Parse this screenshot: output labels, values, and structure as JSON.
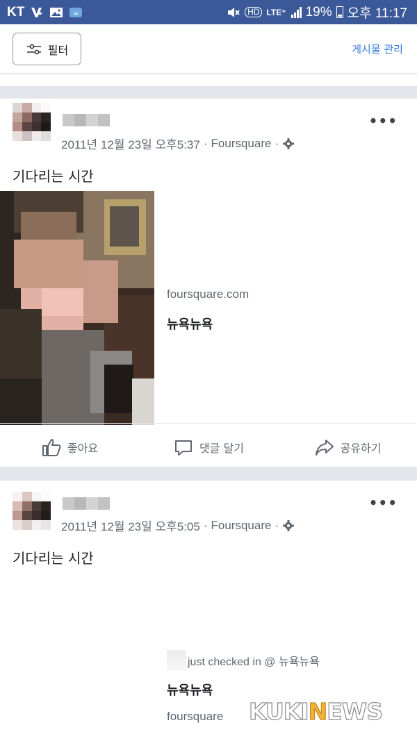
{
  "status_bar": {
    "carrier": "KT",
    "hd_badge": "HD",
    "network": "LTE⁺",
    "battery": "19%",
    "time": "오후 11:17"
  },
  "header": {
    "filter_label": "필터",
    "manage_label": "게시물 관리"
  },
  "posts": [
    {
      "date": "2011년 12월 23일 오후5:37",
      "app": "Foursquare",
      "text": "기다리는 시간",
      "link_domain": "foursquare.com",
      "link_title": "뉴욕뉴욕",
      "actions": {
        "like": "좋아요",
        "comment": "댓글 달기",
        "share": "공유하기"
      }
    },
    {
      "date": "2011년 12월 23일 오후5:05",
      "app": "Foursquare",
      "text": "기다리는 시간",
      "checkin": "just checked in @ 뉴욕뉴욕",
      "link_title": "뉴욕뉴욕",
      "link_source": "foursquare"
    }
  ],
  "watermark": {
    "part1": "KUKI",
    "part2": "N",
    "part3": "EWS"
  },
  "colors": {
    "status_bar": "#3b5998",
    "link": "#3578e5",
    "divider": "#e4e6eb"
  }
}
